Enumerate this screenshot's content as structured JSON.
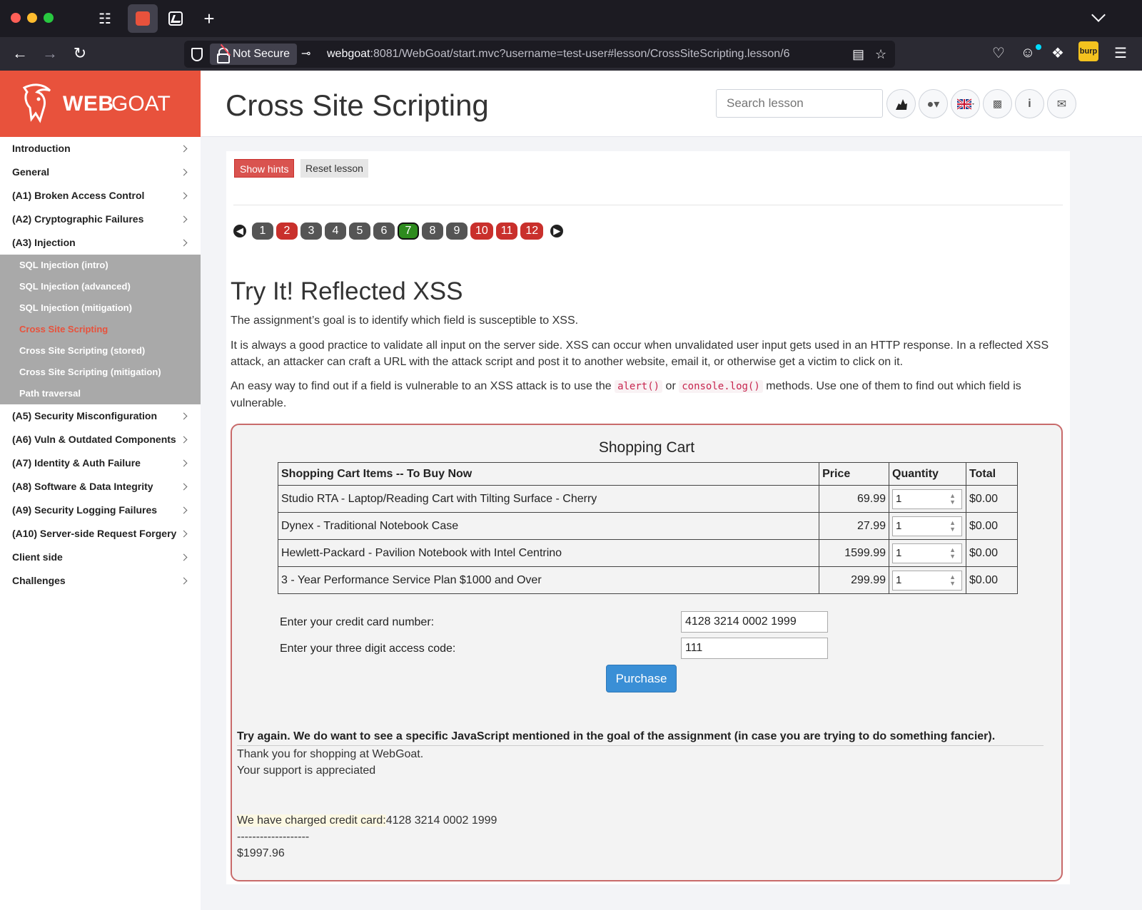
{
  "browser": {
    "not_secure": "Not Secure",
    "url_host": "webgoat",
    "url_rest": ":8081/WebGoat/start.mvc?username=test-user#lesson/CrossSiteScripting.lesson/6",
    "burp_label": "burp"
  },
  "header": {
    "logo_web": "WEB",
    "logo_goat": "GOAT",
    "title": "Cross Site Scripting",
    "search_placeholder": "Search lesson"
  },
  "sidebar": {
    "items_top": [
      {
        "label": "Introduction"
      },
      {
        "label": "General"
      },
      {
        "label": "(A1) Broken Access Control"
      },
      {
        "label": "(A2) Cryptographic Failures"
      },
      {
        "label": "(A3) Injection"
      }
    ],
    "submenu": [
      {
        "label": "SQL Injection (intro)"
      },
      {
        "label": "SQL Injection (advanced)"
      },
      {
        "label": "SQL Injection (mitigation)"
      },
      {
        "label": "Cross Site Scripting"
      },
      {
        "label": "Cross Site Scripting (stored)"
      },
      {
        "label": "Cross Site Scripting (mitigation)"
      },
      {
        "label": "Path traversal"
      }
    ],
    "items_bottom": [
      {
        "label": "(A5) Security Misconfiguration"
      },
      {
        "label": "(A6) Vuln & Outdated Components"
      },
      {
        "label": "(A7) Identity & Auth Failure"
      },
      {
        "label": "(A8) Software & Data Integrity"
      },
      {
        "label": "(A9) Security Logging Failures"
      },
      {
        "label": "(A10) Server-side Request Forgery"
      },
      {
        "label": "Client side"
      },
      {
        "label": "Challenges"
      }
    ]
  },
  "lesson": {
    "show_hints": "Show hints",
    "reset_lesson": "Reset lesson",
    "pages": [
      "1",
      "2",
      "3",
      "4",
      "5",
      "6",
      "7",
      "8",
      "9",
      "10",
      "11",
      "12"
    ],
    "heading": "Try It! Reflected XSS",
    "p1": "The assignment’s goal is to identify which field is susceptible to XSS.",
    "p2": "It is always a good practice to validate all input on the server side. XSS can occur when unvalidated user input gets used in an HTTP response. In a reflected XSS attack, an attacker can craft a URL with the attack script and post it to another website, email it, or otherwise get a victim to click on it.",
    "p3_a": "An easy way to find out if a field is vulnerable to an XSS attack is to use the ",
    "p3_code1": "alert()",
    "p3_or": " or ",
    "p3_code2": "console.log()",
    "p3_b": " methods. Use one of them to find out which field is vulnerable."
  },
  "cart": {
    "title": "Shopping Cart",
    "headers": [
      "Shopping Cart Items -- To Buy Now",
      "Price",
      "Quantity",
      "Total"
    ],
    "rows": [
      {
        "item": "Studio RTA - Laptop/Reading Cart with Tilting Surface - Cherry",
        "price": "69.99",
        "qty": "1",
        "total": "$0.00"
      },
      {
        "item": "Dynex - Traditional Notebook Case",
        "price": "27.99",
        "qty": "1",
        "total": "$0.00"
      },
      {
        "item": "Hewlett-Packard - Pavilion Notebook with Intel Centrino",
        "price": "1599.99",
        "qty": "1",
        "total": "$0.00"
      },
      {
        "item": "3 - Year Performance Service Plan $1000 and Over",
        "price": "299.99",
        "qty": "1",
        "total": "$0.00"
      }
    ],
    "cc_label": "Enter your credit card number:",
    "cc_value": "4128 3214 0002 1999",
    "code_label": "Enter your three digit access code:",
    "code_value": "111",
    "purchase": "Purchase"
  },
  "result": {
    "feedback": "Try again. We do want to see a specific JavaScript mentioned in the goal of the assignment (in case you are trying to do something fancier).",
    "thanks": "Thank you for shopping at WebGoat.",
    "support": "Your support is appreciated",
    "charged_label": "We have charged credit card:",
    "charged_number": "4128 3214 0002 1999",
    "dashes": "-------------------",
    "amount": "$1997.96"
  }
}
